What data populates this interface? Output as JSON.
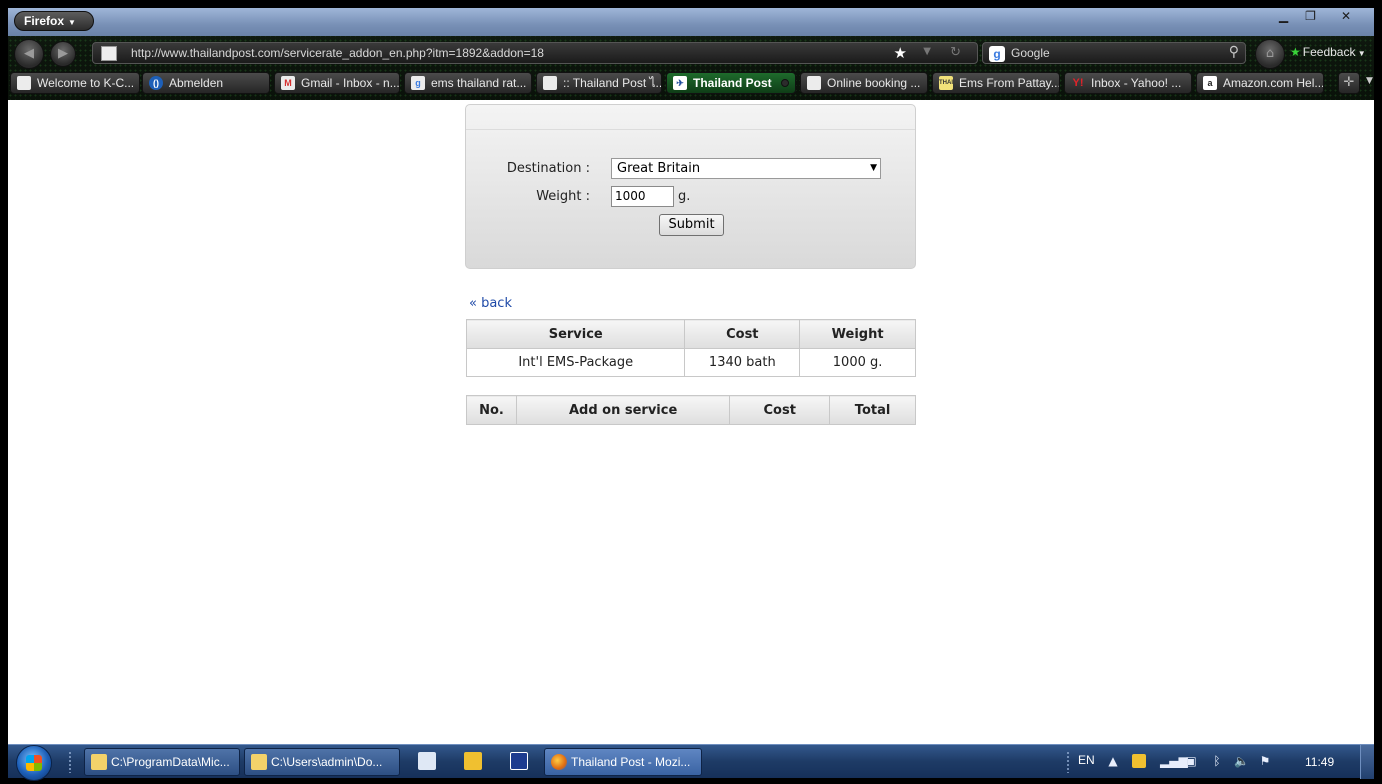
{
  "browser": {
    "menu_label": "Firefox",
    "url": "http://www.thailandpost.com/servicerate_addon_en.php?itm=1892&addon=18",
    "search_engine": "Google",
    "feedback_label": "Feedback",
    "bookmarks": [
      {
        "label": "Welcome to K-C...",
        "icon": "page-icon"
      },
      {
        "label": "Abmelden",
        "icon": "site-icon"
      },
      {
        "label": "Gmail - Inbox - n...",
        "icon": "gmail-icon"
      },
      {
        "label": "ems thailand rat...",
        "icon": "google-icon"
      },
      {
        "label": ":: Thailand Post ไ...",
        "icon": "page-icon"
      },
      {
        "label": "Thailand Post",
        "icon": "thailand-post-icon",
        "active": true
      },
      {
        "label": "Online booking ...",
        "icon": "page-icon"
      },
      {
        "label": "Ems From Pattay...",
        "icon": "thai-visa-icon"
      },
      {
        "label": "Inbox - Yahoo! ...",
        "icon": "yahoo-icon"
      },
      {
        "label": "Amazon.com Hel...",
        "icon": "amazon-icon"
      }
    ]
  },
  "form": {
    "destination_label": "Destination :",
    "destination_value": "Great Britain",
    "weight_label": "Weight :",
    "weight_value": "1000",
    "weight_unit": "g.",
    "submit_label": "Submit"
  },
  "back_link": "« back",
  "service_table": {
    "headers": [
      "Service",
      "Cost",
      "Weight"
    ],
    "rows": [
      [
        "Int'l EMS-Package",
        "1340 bath",
        "1000 g."
      ]
    ]
  },
  "addon_table": {
    "headers": [
      "No.",
      "Add on service",
      "Cost",
      "Total"
    ]
  },
  "taskbar": {
    "tasks": [
      {
        "label": "C:\\ProgramData\\Mic..."
      },
      {
        "label": "C:\\Users\\admin\\Do..."
      },
      {
        "label": "Thailand Post - Mozi...",
        "active": true
      }
    ],
    "language": "EN",
    "clock": "11:49"
  }
}
